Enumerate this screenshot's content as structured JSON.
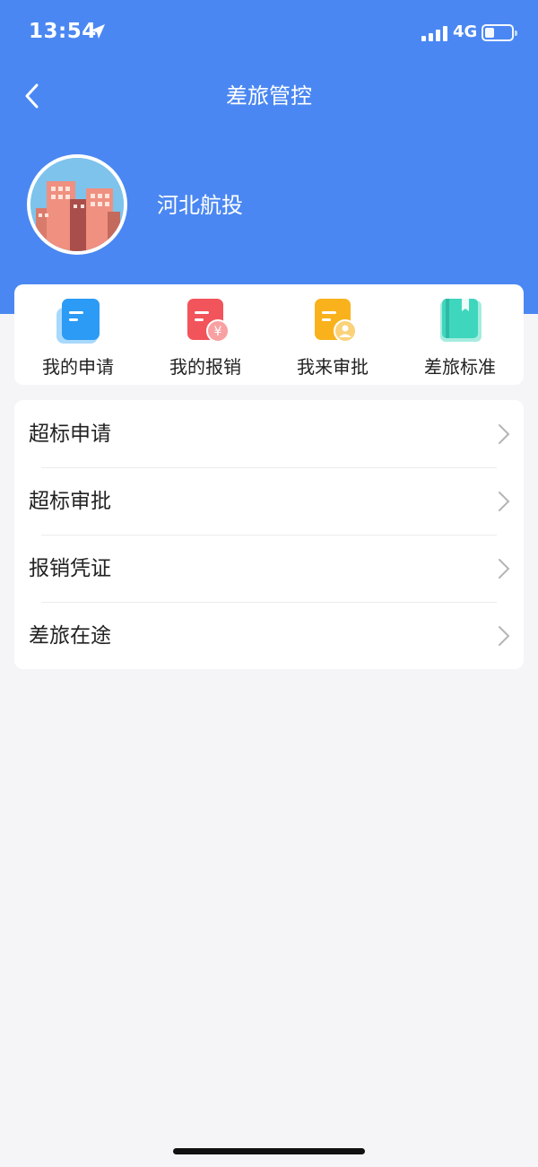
{
  "status_bar": {
    "time": "13:54",
    "network": "4G"
  },
  "nav": {
    "title": "差旅管控"
  },
  "profile": {
    "org_name": "河北航投"
  },
  "quick_actions": [
    {
      "label": "我的申请",
      "icon": "document-icon",
      "color": "#2b9bf5"
    },
    {
      "label": "我的报销",
      "icon": "reimburse-yuan-icon",
      "color": "#f2545b"
    },
    {
      "label": "我来审批",
      "icon": "approve-user-icon",
      "color": "#f9b21c"
    },
    {
      "label": "差旅标准",
      "icon": "book-icon",
      "color": "#3fd6be"
    }
  ],
  "menu": [
    {
      "label": "超标申请"
    },
    {
      "label": "超标审批"
    },
    {
      "label": "报销凭证"
    },
    {
      "label": "差旅在途"
    }
  ],
  "colors": {
    "header": "#4a87f2",
    "background": "#f5f5f7"
  }
}
